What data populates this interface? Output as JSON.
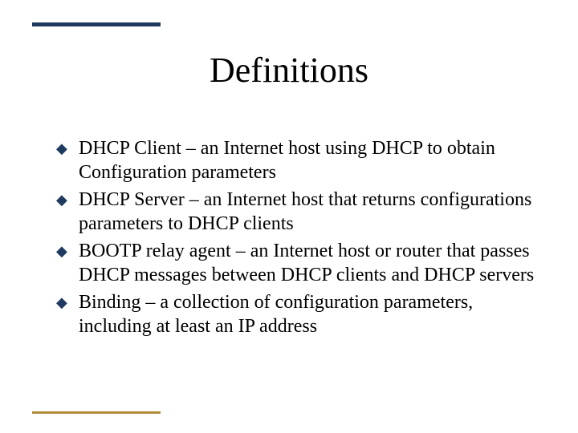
{
  "title": "Definitions",
  "bullets": [
    {
      "text": "DHCP Client – an Internet host using DHCP to obtain Configuration parameters"
    },
    {
      "text": "DHCP Server – an Internet host that returns configurations parameters to DHCP clients"
    },
    {
      "text": "BOOTP relay agent – an Internet host or router that passes DHCP messages between DHCP clients and DHCP servers"
    },
    {
      "text": "Binding – a collection of configuration parameters, including at least an IP address"
    }
  ],
  "colors": {
    "accent_dark": "#1f3a5f",
    "accent_gold": "#b38a3a"
  }
}
